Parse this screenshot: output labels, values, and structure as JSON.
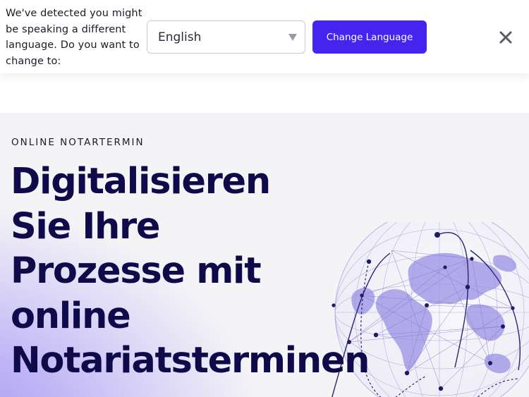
{
  "language_banner": {
    "message": "We've detected you might be speaking a different language. Do you want to change to:",
    "selected_language": "English",
    "change_button_label": "Change Language",
    "close_icon": "close-icon",
    "accent_color": "#4424ee"
  },
  "hero": {
    "eyebrow": "ONLINE NOTARTERMIN",
    "title_lines": [
      "Digitalisieren",
      "Sie Ihre",
      "Prozesse mit",
      "online",
      "Notariatsterminen"
    ],
    "illustration_icon": "globe-network-icon",
    "title_color": "#0f0b4b"
  }
}
